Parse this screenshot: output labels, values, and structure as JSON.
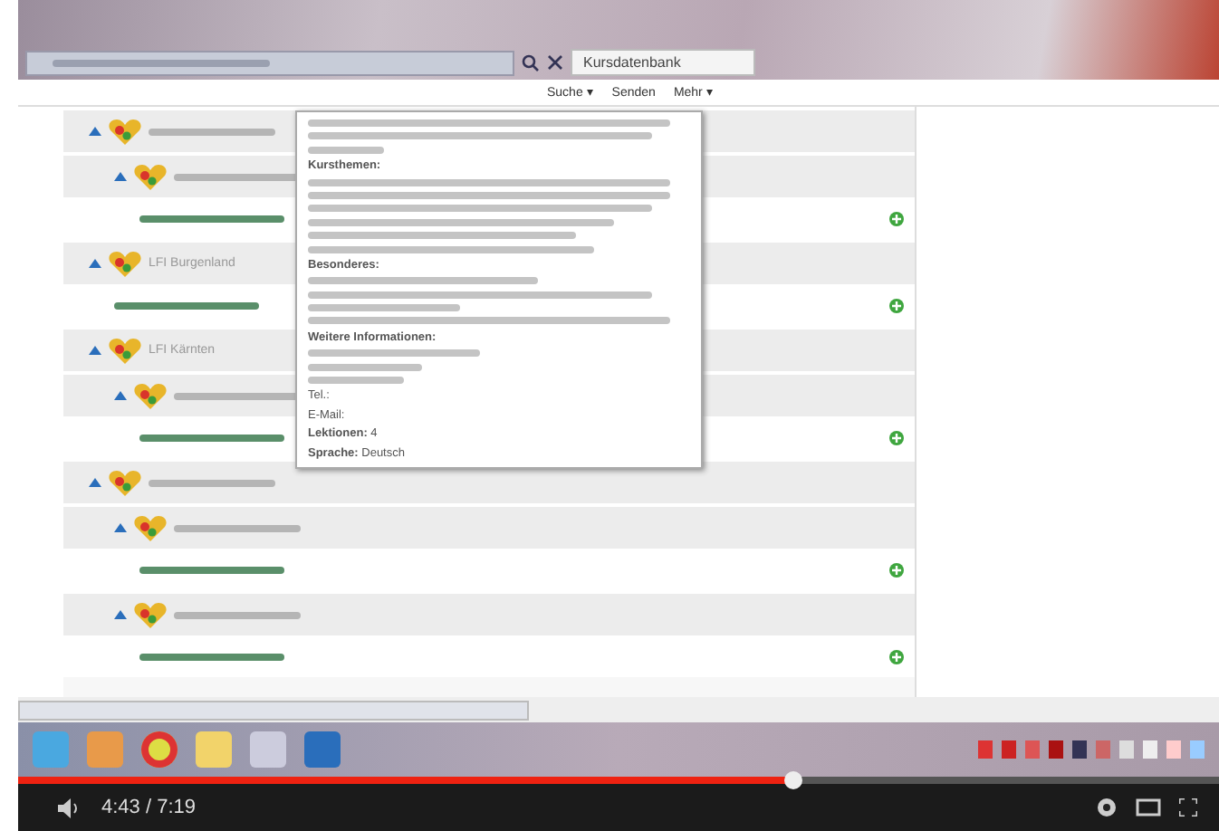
{
  "browser": {
    "tab_title": "Kursdatenbank",
    "command_bar": [
      {
        "label": "Suche ▾"
      },
      {
        "label": "Senden"
      },
      {
        "label": "Mehr ▾"
      }
    ]
  },
  "tree": [
    {
      "kind": "category",
      "expanded": true,
      "children": [
        {
          "kind": "category",
          "expanded": true,
          "children": [
            {
              "kind": "course"
            }
          ]
        }
      ]
    },
    {
      "kind": "category",
      "label": "LFI Burgenland",
      "expanded": true,
      "children": [
        {
          "kind": "course"
        }
      ]
    },
    {
      "kind": "category",
      "label": "LFI Kärnten",
      "expanded": true,
      "children": [
        {
          "kind": "category",
          "expanded": true,
          "children": [
            {
              "kind": "course"
            }
          ]
        }
      ]
    },
    {
      "kind": "category",
      "expanded": true,
      "children": [
        {
          "kind": "category",
          "expanded": true,
          "children": [
            {
              "kind": "course"
            }
          ]
        },
        {
          "kind": "category",
          "expanded": true,
          "children": [
            {
              "kind": "course"
            }
          ]
        }
      ]
    }
  ],
  "tooltip": {
    "lines": [
      {
        "kind": "blur"
      },
      {
        "kind": "blur"
      },
      {
        "kind": "blur"
      },
      {
        "kind": "text",
        "text": "**Kursthemen:**"
      },
      {
        "kind": "blur"
      },
      {
        "kind": "blur"
      },
      {
        "kind": "blur"
      },
      {
        "kind": "blur"
      },
      {
        "kind": "blur"
      },
      {
        "kind": "blur"
      },
      {
        "kind": "text",
        "text": "**Besonderes:**"
      },
      {
        "kind": "blur"
      },
      {
        "kind": "blur"
      },
      {
        "kind": "blur"
      },
      {
        "kind": "blur"
      },
      {
        "kind": "text",
        "text": "**Weitere Informationen:**"
      },
      {
        "kind": "blur"
      },
      {
        "kind": "blur"
      },
      {
        "kind": "blur"
      },
      {
        "kind": "text",
        "text": "Tel.:"
      },
      {
        "kind": "text",
        "text": "E-Mail:"
      },
      {
        "kind": "text",
        "text": "**Lektionen:** 4"
      },
      {
        "kind": "text",
        "text": "**Sprache:** Deutsch"
      }
    ]
  },
  "player": {
    "level": 0.645,
    "time": "4:43 / 7:19"
  }
}
